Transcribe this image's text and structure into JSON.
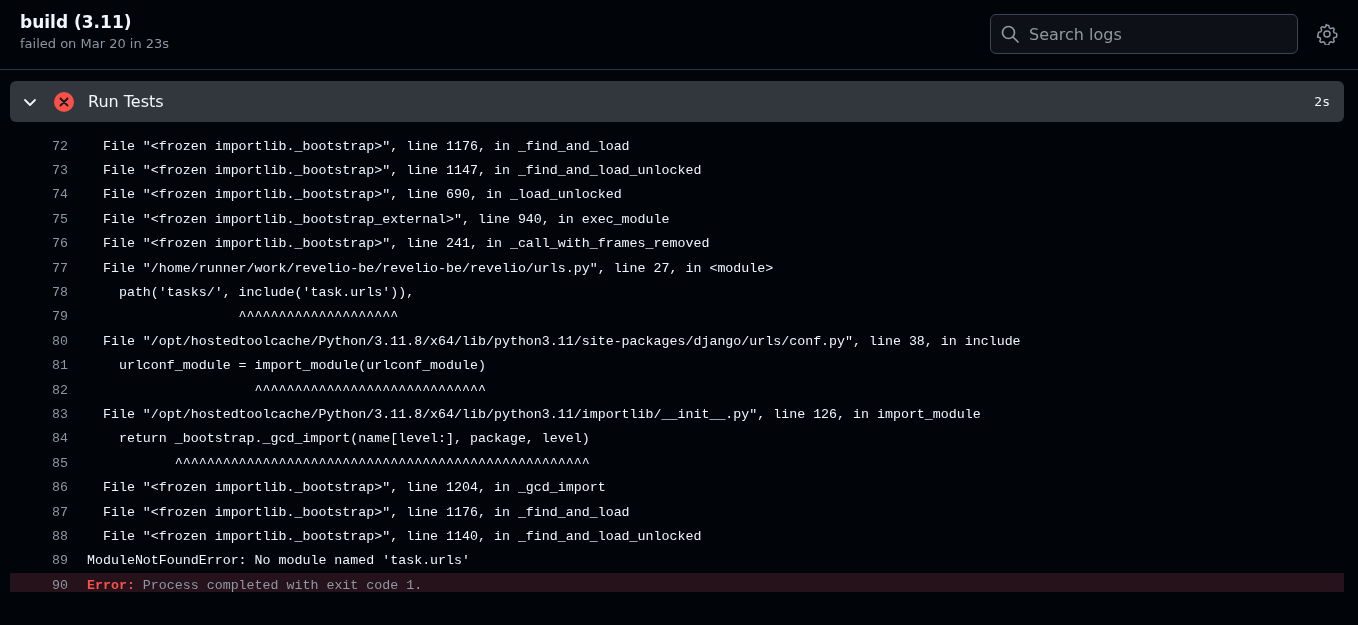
{
  "header": {
    "title": "build (3.11)",
    "subtitle": "failed on Mar 20 in 23s"
  },
  "search": {
    "placeholder": "Search logs"
  },
  "step": {
    "name": "Run Tests",
    "failed": true,
    "expanded": true,
    "duration": "2s"
  },
  "log": [
    {
      "number": "72",
      "kind": "plain",
      "text": "  File \"<frozen importlib._bootstrap>\", line 1176, in _find_and_load"
    },
    {
      "number": "73",
      "kind": "plain",
      "text": "  File \"<frozen importlib._bootstrap>\", line 1147, in _find_and_load_unlocked"
    },
    {
      "number": "74",
      "kind": "plain",
      "text": "  File \"<frozen importlib._bootstrap>\", line 690, in _load_unlocked"
    },
    {
      "number": "75",
      "kind": "plain",
      "text": "  File \"<frozen importlib._bootstrap_external>\", line 940, in exec_module"
    },
    {
      "number": "76",
      "kind": "plain",
      "text": "  File \"<frozen importlib._bootstrap>\", line 241, in _call_with_frames_removed"
    },
    {
      "number": "77",
      "kind": "plain",
      "text": "  File \"/home/runner/work/revelio-be/revelio-be/revelio/urls.py\", line 27, in <module>"
    },
    {
      "number": "78",
      "kind": "plain",
      "text": "    path('tasks/', include('task.urls')),"
    },
    {
      "number": "79",
      "kind": "plain",
      "text": "                   ^^^^^^^^^^^^^^^^^^^^"
    },
    {
      "number": "80",
      "kind": "plain",
      "text": "  File \"/opt/hostedtoolcache/Python/3.11.8/x64/lib/python3.11/site-packages/django/urls/conf.py\", line 38, in include"
    },
    {
      "number": "81",
      "kind": "plain",
      "text": "    urlconf_module = import_module(urlconf_module)"
    },
    {
      "number": "82",
      "kind": "plain",
      "text": "                     ^^^^^^^^^^^^^^^^^^^^^^^^^^^^^"
    },
    {
      "number": "83",
      "kind": "plain",
      "text": "  File \"/opt/hostedtoolcache/Python/3.11.8/x64/lib/python3.11/importlib/__init__.py\", line 126, in import_module"
    },
    {
      "number": "84",
      "kind": "plain",
      "text": "    return _bootstrap._gcd_import(name[level:], package, level)"
    },
    {
      "number": "85",
      "kind": "plain",
      "text": "           ^^^^^^^^^^^^^^^^^^^^^^^^^^^^^^^^^^^^^^^^^^^^^^^^^^^^"
    },
    {
      "number": "86",
      "kind": "plain",
      "text": "  File \"<frozen importlib._bootstrap>\", line 1204, in _gcd_import"
    },
    {
      "number": "87",
      "kind": "plain",
      "text": "  File \"<frozen importlib._bootstrap>\", line 1176, in _find_and_load"
    },
    {
      "number": "88",
      "kind": "plain",
      "text": "  File \"<frozen importlib._bootstrap>\", line 1140, in _find_and_load_unlocked"
    },
    {
      "number": "89",
      "kind": "plain",
      "text": "ModuleNotFoundError: No module named 'task.urls'"
    },
    {
      "number": "90",
      "kind": "error",
      "prefix": "Error:",
      "text": " Process completed with exit code 1."
    }
  ]
}
